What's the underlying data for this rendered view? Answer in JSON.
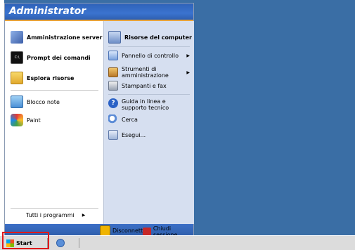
{
  "header": {
    "user": "Administrator"
  },
  "left_items": [
    {
      "label": "Amministrazione server",
      "icon": "server-manager-icon"
    },
    {
      "label": "Prompt dei comandi",
      "icon": "command-prompt-icon"
    },
    {
      "label": "Esplora risorse",
      "icon": "explorer-icon"
    },
    {
      "label": "Blocco note",
      "icon": "notepad-icon"
    },
    {
      "label": "Paint",
      "icon": "paint-icon"
    }
  ],
  "all_programs": {
    "label": "Tutti i programmi",
    "arrow": "▶"
  },
  "right_items": [
    {
      "label": "Risorse del computer",
      "icon": "my-computer-icon"
    },
    {
      "label": "Pannello di controllo",
      "icon": "control-panel-icon",
      "arrow": "▶"
    },
    {
      "label": "Strumenti di amministrazione",
      "icon": "admin-tools-icon",
      "arrow": "▶"
    },
    {
      "label": "Stampanti e fax",
      "icon": "printers-icon"
    },
    {
      "label": "Guida in linea e supporto tecnico",
      "icon": "help-icon"
    },
    {
      "label": "Cerca",
      "icon": "search-icon"
    },
    {
      "label": "Esegui...",
      "icon": "run-icon"
    }
  ],
  "bottom": {
    "logoff": "Disconnetti",
    "shutdown": "Chiudi sessione"
  },
  "taskbar": {
    "start_label": "Start"
  },
  "colors": {
    "desktop": "#3a6ea5",
    "header": "#2e62b8",
    "highlight": "#e0191b"
  }
}
